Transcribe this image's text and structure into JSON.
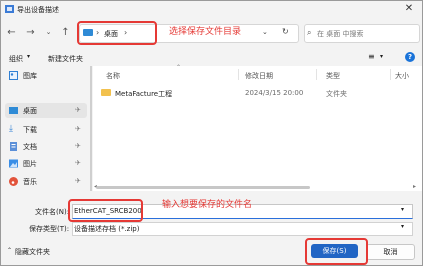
{
  "window": {
    "title": "导出设备描述"
  },
  "nav": {
    "breadcrumb": "桌面",
    "search_placeholder": "在 桌面 中搜索"
  },
  "toolbar": {
    "organize": "组织",
    "new_folder": "新建文件夹"
  },
  "sidebar": {
    "items": [
      {
        "label": "图库",
        "icon": "gallery-icon"
      },
      {
        "label": "桌面",
        "icon": "desktop-icon"
      },
      {
        "label": "下载",
        "icon": "download-icon"
      },
      {
        "label": "文档",
        "icon": "document-icon"
      },
      {
        "label": "图片",
        "icon": "pictures-icon"
      },
      {
        "label": "音乐",
        "icon": "music-icon"
      }
    ]
  },
  "file_list": {
    "columns": [
      "名称",
      "修改日期",
      "类型",
      "大小"
    ],
    "rows": [
      {
        "name": "MetaFacture工程",
        "modified": "2024/3/15 20:00",
        "type": "文件夹"
      }
    ]
  },
  "bottom": {
    "filename_label": "文件名(N):",
    "filename_value": "EtherCAT_SRCB200",
    "filetype_label": "保存类型(T):",
    "filetype_value": "设备描述存档 (*.zip)",
    "hide_folders": "隐藏文件夹",
    "save_label": "保存(S)",
    "cancel_label": "取消"
  },
  "annotations": {
    "directory_hint": "选择保存文件目录",
    "filename_hint": "输入想要保存的文件名"
  },
  "colors": {
    "accent": "#2165c4",
    "annotation": "#e53935",
    "folder": "#f2c14e"
  }
}
